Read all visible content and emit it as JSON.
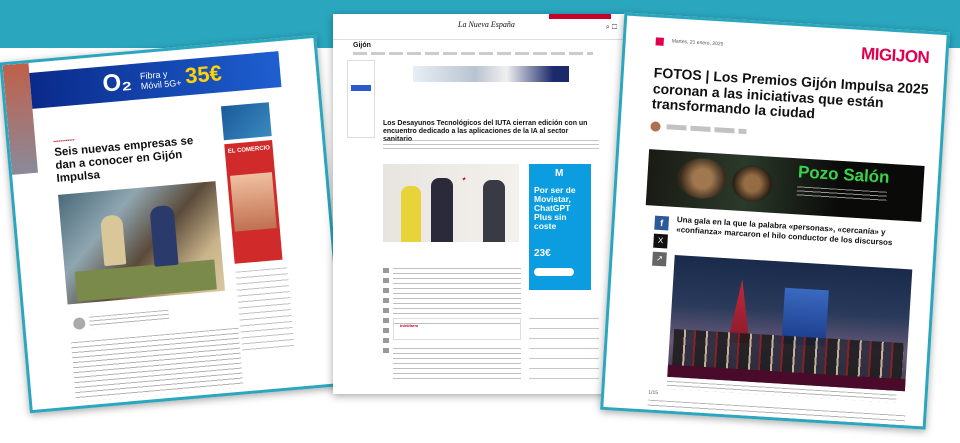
{
  "left_card": {
    "ad": {
      "brand": "O₂",
      "line1": "Fibra y",
      "line2": "Móvil 5G+",
      "price": "35€"
    },
    "headline": "Seis nuevas empresas se dan a conocer en Gijón Impulsa",
    "side_ad_title": "EL COMERCIO"
  },
  "center_card": {
    "masthead": "La Nueva España",
    "section": "Gijón",
    "headline": "Los Desayunos Tecnológicos del IUTA cierran edición con un encuentro dedicado a las aplicaciones de la IA al sector sanitario",
    "movistar_ad": {
      "logo": "M",
      "text": "Por ser de Movistar, ChatGPT Plus sin coste",
      "price": "23€"
    },
    "box_label": "Intelifarm"
  },
  "right_card": {
    "date": "Martes, 21 enero, 2025",
    "logo": "MIGIJON",
    "headline": "FOTOS | Los Premios Gijón Impulsa 2025 coronan a las iniciativas que están transformando la ciudad",
    "ad": {
      "title": "Pozo Salón"
    },
    "lead": "Una gala en la que la palabra «personas», «cercanía» y «confianza» marcaron el hilo conductor de los discursos",
    "share": {
      "facebook": "f",
      "x": "X",
      "share": "↗"
    },
    "counter": "1/15"
  }
}
